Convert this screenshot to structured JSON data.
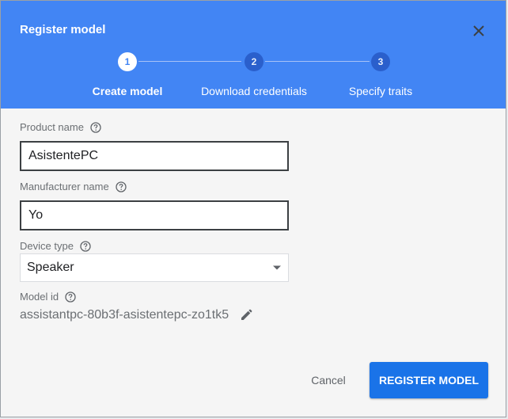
{
  "dialog": {
    "title": "Register model",
    "steps": [
      {
        "number": "1",
        "label": "Create model",
        "state": "active"
      },
      {
        "number": "2",
        "label": "Download credentials",
        "state": "inactive"
      },
      {
        "number": "3",
        "label": "Specify traits",
        "state": "inactive"
      }
    ]
  },
  "form": {
    "product_name": {
      "label": "Product name",
      "value": "AsistentePC"
    },
    "manufacturer_name": {
      "label": "Manufacturer name",
      "value": "Yo"
    },
    "device_type": {
      "label": "Device type",
      "selected": "Speaker"
    },
    "model_id": {
      "label": "Model id",
      "value": "assistantpc-80b3f-asistentepc-zo1tk5"
    }
  },
  "actions": {
    "cancel_label": "Cancel",
    "register_label": "REGISTER MODEL"
  },
  "colors": {
    "header": "#4285f4",
    "primary_button": "#1a73e8"
  },
  "icons": [
    "close-icon",
    "help-icon",
    "dropdown-arrow-icon",
    "edit-icon"
  ]
}
